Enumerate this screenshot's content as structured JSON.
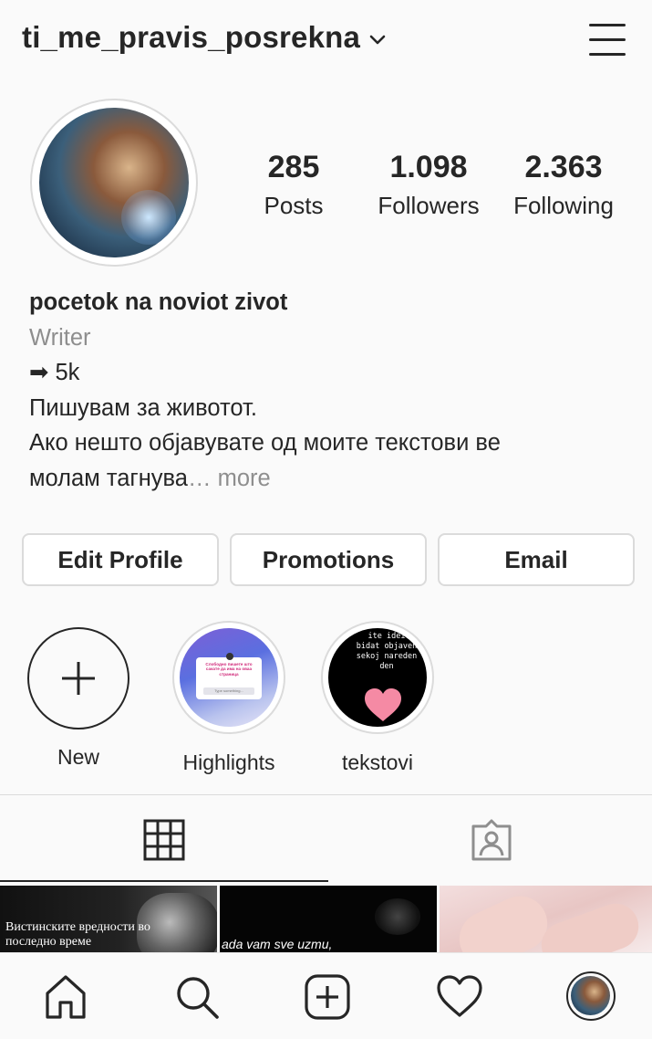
{
  "header": {
    "username": "ti_me_pravis_posrekna"
  },
  "stats": [
    {
      "value": "285",
      "label": "Posts"
    },
    {
      "value": "1.098",
      "label": "Followers"
    },
    {
      "value": "2.363",
      "label": "Following"
    }
  ],
  "bio": {
    "name": "pocetok na noviot zivot",
    "category": "Writer",
    "line1": "➡ 5k",
    "line2": "Пишувам за животот.",
    "line3": "Ако нешто објавувате од моите текстови ве",
    "line4": "молам тагнува",
    "ellipsis": "…",
    "more": "more"
  },
  "buttons": {
    "edit": "Edit Profile",
    "promotions": "Promotions",
    "email": "Email"
  },
  "highlights": [
    {
      "label": "New"
    },
    {
      "label": "Highlights",
      "card_text": "Слободно пишете што сакате да има на оваа страница",
      "input_placeholder": "Type something..."
    },
    {
      "label": "tekstovi",
      "cover_text": "ite idei\nbidat objaven\nsekoj nareden\nden"
    }
  ],
  "posts": [
    {
      "text": "Вистинските вредности во последно време"
    },
    {
      "text": "ada vam sve uzmu,"
    },
    {
      "text": ""
    }
  ],
  "icons": {
    "chevron": "chevron-down-icon",
    "menu": "hamburger-menu-icon",
    "grid": "grid-icon",
    "tagged": "tagged-photos-icon",
    "home": "home-icon",
    "search": "search-icon",
    "add": "add-post-icon",
    "activity": "heart-icon",
    "profile": "profile-avatar-icon"
  }
}
